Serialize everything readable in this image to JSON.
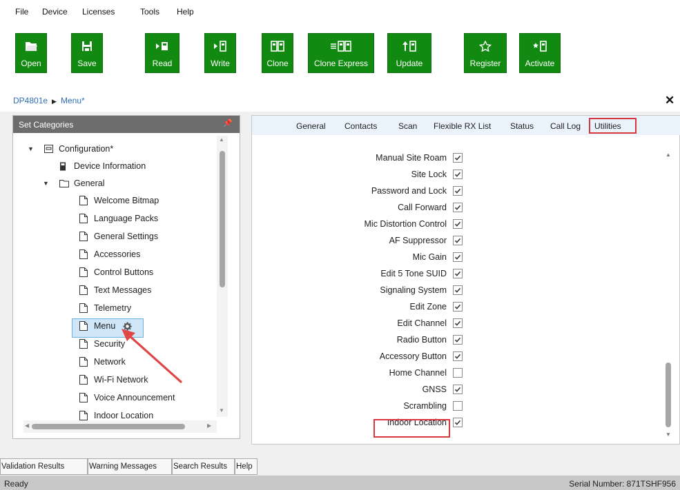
{
  "menu": [
    "File",
    "Device",
    "Licenses",
    "Tools",
    "Help"
  ],
  "toolbar": {
    "open": "Open",
    "save": "Save",
    "read": "Read",
    "write": "Write",
    "clone": "Clone",
    "clone_express": "Clone Express",
    "update": "Update",
    "register": "Register",
    "activate": "Activate"
  },
  "breadcrumb": {
    "device": "DP4801e",
    "page": "Menu*"
  },
  "categories": {
    "title": "Set Categories",
    "configuration": "Configuration*",
    "device_information": "Device Information",
    "general": "General",
    "items": [
      "Welcome Bitmap",
      "Language Packs",
      "General Settings",
      "Accessories",
      "Control Buttons",
      "Text Messages",
      "Telemetry",
      "Menu",
      "Security",
      "Network",
      "Wi-Fi Network",
      "Voice Announcement",
      "Indoor Location"
    ]
  },
  "tabs": [
    "General",
    "Contacts",
    "Scan",
    "Flexible RX List",
    "Status",
    "Call Log",
    "Utilities"
  ],
  "active_tab": "Utilities",
  "options": [
    {
      "label": "Manual Site Roam",
      "checked": true
    },
    {
      "label": "Site Lock",
      "checked": true
    },
    {
      "label": "Password and Lock",
      "checked": true
    },
    {
      "label": "Call Forward",
      "checked": true
    },
    {
      "label": "Mic Distortion Control",
      "checked": true
    },
    {
      "label": "AF Suppressor",
      "checked": true
    },
    {
      "label": "Mic Gain",
      "checked": true
    },
    {
      "label": "Edit 5 Tone SUID",
      "checked": true
    },
    {
      "label": "Signaling System",
      "checked": true
    },
    {
      "label": "Edit Zone",
      "checked": true
    },
    {
      "label": "Edit Channel",
      "checked": true
    },
    {
      "label": "Radio Button",
      "checked": true
    },
    {
      "label": "Accessory Button",
      "checked": true
    },
    {
      "label": "Home Channel",
      "checked": false
    },
    {
      "label": "GNSS",
      "checked": true
    },
    {
      "label": "Scrambling",
      "checked": false
    },
    {
      "label": "Indoor Location",
      "checked": true
    }
  ],
  "bottom_tabs": [
    "Validation Results",
    "Warning Messages",
    "Search Results",
    "Help"
  ],
  "status": {
    "left": "Ready",
    "right": "Serial Number: 871TSHF956"
  },
  "colors": {
    "toolbar_green": "#128a12",
    "highlight_red": "#d9363e",
    "link_blue": "#2f6fb8",
    "selection_blue": "#cfe6f8"
  }
}
